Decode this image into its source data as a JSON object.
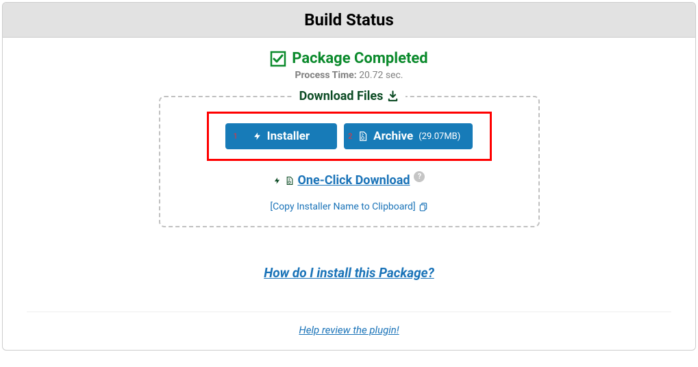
{
  "header": {
    "title": "Build Status"
  },
  "status": {
    "text": "Package Completed",
    "process_time_label": "Process Time:",
    "process_time_value": "20.72 sec."
  },
  "download": {
    "title": "Download Files",
    "installer": {
      "label": "Installer",
      "badge": "1"
    },
    "archive": {
      "label": "Archive",
      "size": "(29.07MB)",
      "badge": "2"
    },
    "oneclick": {
      "label": "One-Click Download"
    },
    "copy": {
      "label": "[Copy Installer Name to Clipboard]"
    }
  },
  "help": {
    "install_link": "How do I install this Package?",
    "review_link": "Help review the plugin!"
  },
  "colors": {
    "green": "#0b8a2c",
    "blue_btn": "#177bb8",
    "blue_link": "#1a73b8",
    "red": "#ff0000"
  }
}
